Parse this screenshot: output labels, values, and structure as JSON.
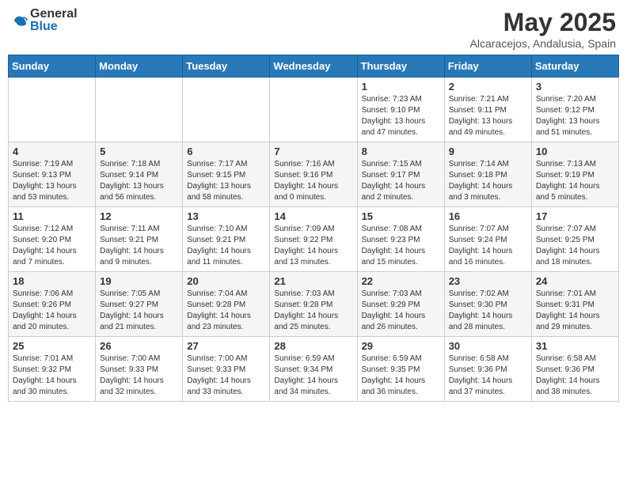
{
  "header": {
    "logo_general": "General",
    "logo_blue": "Blue",
    "month_year": "May 2025",
    "location": "Alcaracejos, Andalusia, Spain"
  },
  "days_of_week": [
    "Sunday",
    "Monday",
    "Tuesday",
    "Wednesday",
    "Thursday",
    "Friday",
    "Saturday"
  ],
  "weeks": [
    [
      {
        "day": "",
        "info": ""
      },
      {
        "day": "",
        "info": ""
      },
      {
        "day": "",
        "info": ""
      },
      {
        "day": "",
        "info": ""
      },
      {
        "day": "1",
        "info": "Sunrise: 7:23 AM\nSunset: 9:10 PM\nDaylight: 13 hours\nand 47 minutes."
      },
      {
        "day": "2",
        "info": "Sunrise: 7:21 AM\nSunset: 9:11 PM\nDaylight: 13 hours\nand 49 minutes."
      },
      {
        "day": "3",
        "info": "Sunrise: 7:20 AM\nSunset: 9:12 PM\nDaylight: 13 hours\nand 51 minutes."
      }
    ],
    [
      {
        "day": "4",
        "info": "Sunrise: 7:19 AM\nSunset: 9:13 PM\nDaylight: 13 hours\nand 53 minutes."
      },
      {
        "day": "5",
        "info": "Sunrise: 7:18 AM\nSunset: 9:14 PM\nDaylight: 13 hours\nand 56 minutes."
      },
      {
        "day": "6",
        "info": "Sunrise: 7:17 AM\nSunset: 9:15 PM\nDaylight: 13 hours\nand 58 minutes."
      },
      {
        "day": "7",
        "info": "Sunrise: 7:16 AM\nSunset: 9:16 PM\nDaylight: 14 hours\nand 0 minutes."
      },
      {
        "day": "8",
        "info": "Sunrise: 7:15 AM\nSunset: 9:17 PM\nDaylight: 14 hours\nand 2 minutes."
      },
      {
        "day": "9",
        "info": "Sunrise: 7:14 AM\nSunset: 9:18 PM\nDaylight: 14 hours\nand 3 minutes."
      },
      {
        "day": "10",
        "info": "Sunrise: 7:13 AM\nSunset: 9:19 PM\nDaylight: 14 hours\nand 5 minutes."
      }
    ],
    [
      {
        "day": "11",
        "info": "Sunrise: 7:12 AM\nSunset: 9:20 PM\nDaylight: 14 hours\nand 7 minutes."
      },
      {
        "day": "12",
        "info": "Sunrise: 7:11 AM\nSunset: 9:21 PM\nDaylight: 14 hours\nand 9 minutes."
      },
      {
        "day": "13",
        "info": "Sunrise: 7:10 AM\nSunset: 9:21 PM\nDaylight: 14 hours\nand 11 minutes."
      },
      {
        "day": "14",
        "info": "Sunrise: 7:09 AM\nSunset: 9:22 PM\nDaylight: 14 hours\nand 13 minutes."
      },
      {
        "day": "15",
        "info": "Sunrise: 7:08 AM\nSunset: 9:23 PM\nDaylight: 14 hours\nand 15 minutes."
      },
      {
        "day": "16",
        "info": "Sunrise: 7:07 AM\nSunset: 9:24 PM\nDaylight: 14 hours\nand 16 minutes."
      },
      {
        "day": "17",
        "info": "Sunrise: 7:07 AM\nSunset: 9:25 PM\nDaylight: 14 hours\nand 18 minutes."
      }
    ],
    [
      {
        "day": "18",
        "info": "Sunrise: 7:06 AM\nSunset: 9:26 PM\nDaylight: 14 hours\nand 20 minutes."
      },
      {
        "day": "19",
        "info": "Sunrise: 7:05 AM\nSunset: 9:27 PM\nDaylight: 14 hours\nand 21 minutes."
      },
      {
        "day": "20",
        "info": "Sunrise: 7:04 AM\nSunset: 9:28 PM\nDaylight: 14 hours\nand 23 minutes."
      },
      {
        "day": "21",
        "info": "Sunrise: 7:03 AM\nSunset: 9:28 PM\nDaylight: 14 hours\nand 25 minutes."
      },
      {
        "day": "22",
        "info": "Sunrise: 7:03 AM\nSunset: 9:29 PM\nDaylight: 14 hours\nand 26 minutes."
      },
      {
        "day": "23",
        "info": "Sunrise: 7:02 AM\nSunset: 9:30 PM\nDaylight: 14 hours\nand 28 minutes."
      },
      {
        "day": "24",
        "info": "Sunrise: 7:01 AM\nSunset: 9:31 PM\nDaylight: 14 hours\nand 29 minutes."
      }
    ],
    [
      {
        "day": "25",
        "info": "Sunrise: 7:01 AM\nSunset: 9:32 PM\nDaylight: 14 hours\nand 30 minutes."
      },
      {
        "day": "26",
        "info": "Sunrise: 7:00 AM\nSunset: 9:33 PM\nDaylight: 14 hours\nand 32 minutes."
      },
      {
        "day": "27",
        "info": "Sunrise: 7:00 AM\nSunset: 9:33 PM\nDaylight: 14 hours\nand 33 minutes."
      },
      {
        "day": "28",
        "info": "Sunrise: 6:59 AM\nSunset: 9:34 PM\nDaylight: 14 hours\nand 34 minutes."
      },
      {
        "day": "29",
        "info": "Sunrise: 6:59 AM\nSunset: 9:35 PM\nDaylight: 14 hours\nand 36 minutes."
      },
      {
        "day": "30",
        "info": "Sunrise: 6:58 AM\nSunset: 9:36 PM\nDaylight: 14 hours\nand 37 minutes."
      },
      {
        "day": "31",
        "info": "Sunrise: 6:58 AM\nSunset: 9:36 PM\nDaylight: 14 hours\nand 38 minutes."
      }
    ]
  ]
}
